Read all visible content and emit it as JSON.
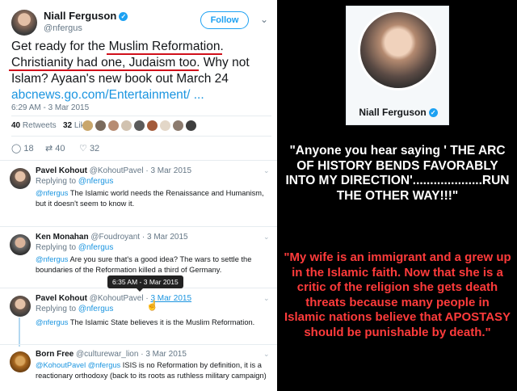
{
  "tweet": {
    "author_name": "Niall Ferguson",
    "handle": "@nfergus",
    "follow_label": "Follow",
    "text_1": "Get ready for the ",
    "text_ul1": "Muslim Reformation",
    "text_2": ". ",
    "text_ul2": "Christianity had one, Judaism too",
    "text_3": ". Why not Islam? Ayaan's new book out March 24 ",
    "link": "abcnews.go.com/Entertainment/",
    "link_tail": " ...",
    "timestamp": "6:29 AM - 3 Mar 2015",
    "retweets_count": "40",
    "retweets_label": "Retweets",
    "likes_count": "32",
    "likes_label": "Likes",
    "reply_count": "18",
    "retweet_action_count": "40",
    "like_action_count": "32"
  },
  "replies": [
    {
      "name": "Pavel Kohout",
      "handle": "@KohoutPavel",
      "date": "3 Mar 2015",
      "replying_to": "@nfergus",
      "mention": "@nfergus",
      "text": " The Islamic world needs the Renaissance and Humanism, but it doesn't seem to know it."
    },
    {
      "name": "Ken Monahan",
      "handle": "@Foudroyant",
      "date": "3 Mar 2015",
      "replying_to": "@nfergus",
      "mention": "@nfergus",
      "text": " Are you sure that's a good idea? The wars to settle the boundaries of the Reformation killed a third of Germany."
    },
    {
      "name": "Pavel Kohout",
      "handle": "@KohoutPavel",
      "date": "3 Mar 2015",
      "replying_to": "@nfergus",
      "mention": "@nfergus",
      "text": " The Islamic State believes it is the Muslim Reformation."
    },
    {
      "name": "Born Free",
      "handle": "@culturewar_lion",
      "date": "3 Mar 2015",
      "mention": "@KohoutPavel @nfergus",
      "text": " ISIS is no Reformation by definition, it is a reactionary orthodoxy (back to its roots as ruthless military campaign)"
    }
  ],
  "tooltip": "6:35 AM - 3 Mar 2015",
  "reply_prefix": "Replying to",
  "date_sep": " · ",
  "right_panel": {
    "profile_name": "Niall Ferguson",
    "quote_1": "\"Anyone you hear saying ' THE ARC OF HISTORY BENDS FAVORABLY INTO MY DIRECTION'....................RUN THE OTHER WAY!!!\"",
    "quote_2": "\"My wife is an immigrant and a grew up in the Islamic faith. Now that she is a critic of the religion she gets death threats because many people in Islamic nations believe that APOSTASY should be punishable by death.\""
  },
  "colors": {
    "accent": "#1da1f2",
    "link": "#1b95e0",
    "underline": "#d0101a",
    "quote_red": "#ff3b3b"
  }
}
